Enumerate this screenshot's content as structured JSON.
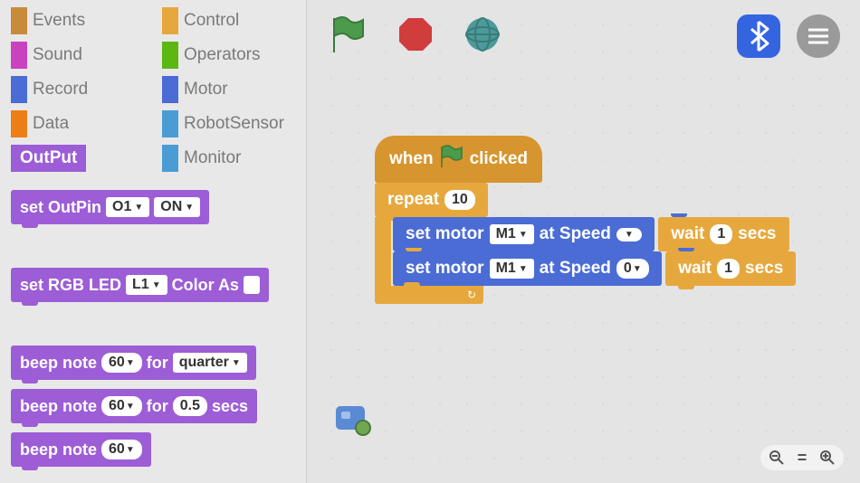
{
  "categories": [
    {
      "label": "Events",
      "color": "#c78b3a"
    },
    {
      "label": "Control",
      "color": "#e6a83d"
    },
    {
      "label": "Sound",
      "color": "#c943c1"
    },
    {
      "label": "Operators",
      "color": "#5cb712"
    },
    {
      "label": "Record",
      "color": "#4a6cd4"
    },
    {
      "label": "Motor",
      "color": "#4a6cd4"
    },
    {
      "label": "Data",
      "color": "#ee7d16"
    },
    {
      "label": "RobotSensor",
      "color": "#4a9cd4"
    },
    {
      "label": "OutPut",
      "color": "#9c5dd6",
      "active": true
    },
    {
      "label": "Monitor",
      "color": "#4a9cd4"
    }
  ],
  "palette_blocks": {
    "set_outpin": {
      "prefix": "set OutPin",
      "arg1": "O1",
      "arg2": "ON"
    },
    "set_rgb": {
      "prefix": "set RGB LED",
      "arg1": "L1",
      "mid": "Color As"
    },
    "beep_for_quarter": {
      "prefix": "beep note",
      "arg1": "60",
      "mid": "for",
      "arg2": "quarter"
    },
    "beep_for_secs": {
      "prefix": "beep note",
      "arg1": "60",
      "mid": "for",
      "arg2": "0.5",
      "suffix": "secs"
    },
    "beep": {
      "prefix": "beep note",
      "arg1": "60"
    }
  },
  "script": {
    "hat": {
      "prefix": "when",
      "suffix": "clicked"
    },
    "repeat": {
      "label": "repeat",
      "count": "10"
    },
    "set_motor1": {
      "prefix": "set motor",
      "arg1": "M1",
      "mid": "at Speed",
      "arg2": ""
    },
    "wait1": {
      "label": "wait",
      "count": "1",
      "suffix": "secs"
    },
    "set_motor2": {
      "prefix": "set motor",
      "arg1": "M1",
      "mid": "at Speed",
      "arg2": "0"
    },
    "wait2": {
      "label": "wait",
      "count": "1",
      "suffix": "secs"
    }
  }
}
